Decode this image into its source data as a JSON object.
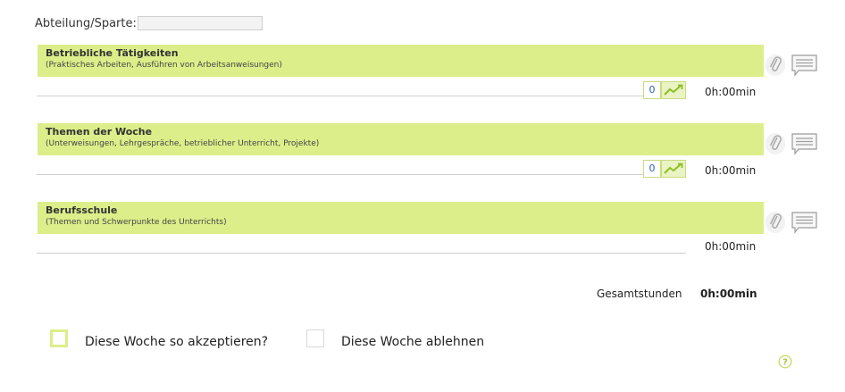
{
  "header": {
    "department_label": "Abteilung/Sparte:",
    "department_value": ""
  },
  "sections": [
    {
      "title": "Betriebliche Tätigkeiten",
      "subtitle": "(Praktisches Arbeiten, Ausführen von Arbeitsanweisungen)",
      "count": "0",
      "time": "0h:00min"
    },
    {
      "title": "Themen der Woche",
      "subtitle": "(Unterweisungen, Lehrgespräche, betrieblicher Unterricht, Projekte)",
      "count": "0",
      "time": "0h:00min"
    },
    {
      "title": "Berufsschule",
      "subtitle": "(Themen und Schwerpunkte des Unterrichts)",
      "time": "0h:00min"
    }
  ],
  "totals": {
    "label": "Gesamtstunden",
    "value": "0h:00min"
  },
  "actions": {
    "accept_label": "Diese Woche so akzeptieren?",
    "reject_label": "Diese Woche ablehnen",
    "accept_checked": false,
    "reject_checked": false
  },
  "icons": {
    "attach": "paperclip-icon",
    "comment": "comment-icon",
    "trend": "trend-chart-icon",
    "help": "help-icon"
  },
  "colors": {
    "band": "#dcee8a",
    "accent_green": "#8cbf26",
    "count_blue": "#2a5db0"
  }
}
